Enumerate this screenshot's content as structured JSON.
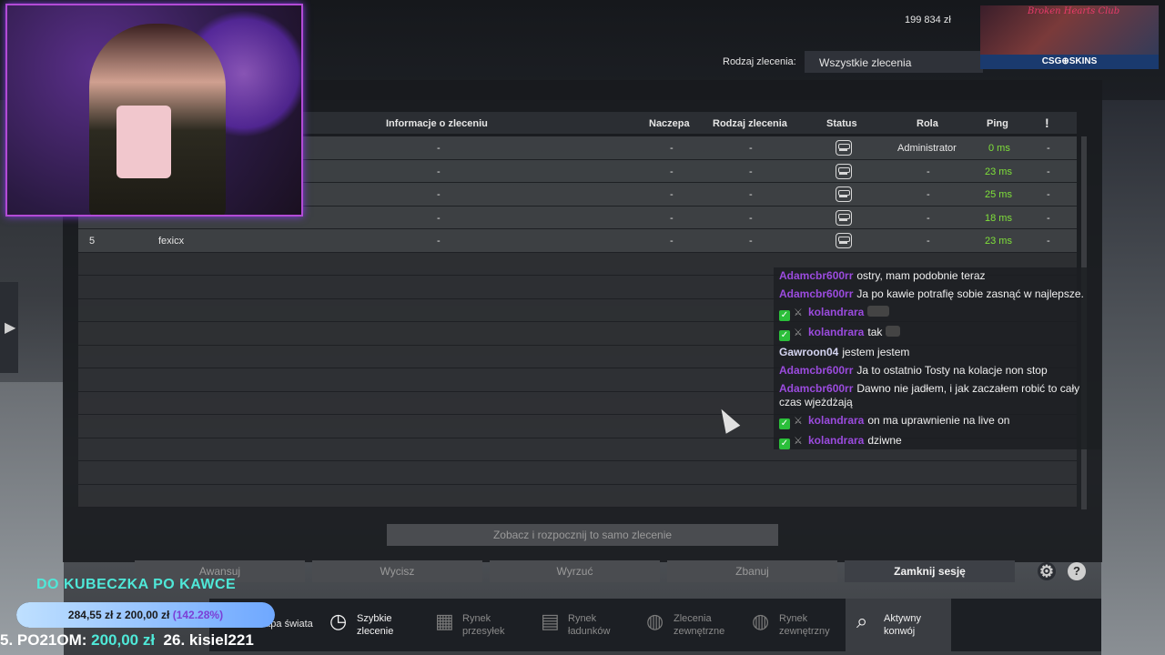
{
  "header": {
    "money": "199 834 zł",
    "order_type_label": "Rodzaj zlecenia:",
    "order_type_value": "Wszystkie zlecenia"
  },
  "sponsor": {
    "club_text": "Broken Hearts Club",
    "brand": "CSG⊕SKINS"
  },
  "table": {
    "columns": [
      "Informacje o zleceniu",
      "Naczepa",
      "Rodzaj zlecenia",
      "Status",
      "Rola",
      "Ping",
      "!"
    ],
    "rows": [
      {
        "num": "",
        "name": "",
        "info": "-",
        "trailer": "-",
        "type": "-",
        "role": "Administrator",
        "ping": "0 ms",
        "flag": "-"
      },
      {
        "num": "",
        "name": "",
        "info": "-",
        "trailer": "-",
        "type": "-",
        "role": "-",
        "ping": "23 ms",
        "flag": "-"
      },
      {
        "num": "",
        "name": "",
        "info": "-",
        "trailer": "-",
        "type": "-",
        "role": "-",
        "ping": "25 ms",
        "flag": "-"
      },
      {
        "num": "",
        "name": "",
        "info": "-",
        "trailer": "-",
        "type": "-",
        "role": "-",
        "ping": "18 ms",
        "flag": "-"
      },
      {
        "num": "5",
        "name": "fexicx",
        "info": "-",
        "trailer": "-",
        "type": "-",
        "role": "-",
        "ping": "23 ms",
        "flag": "-"
      }
    ]
  },
  "buttons": {
    "view_same": "Zobacz i rozpocznij to samo zlecenie",
    "promote": "Awansuj",
    "mute": "Wycisz",
    "kick": "Wyrzuć",
    "ban": "Zbanuj",
    "close_session": "Zamknij sesję",
    "help": "?"
  },
  "nav": {
    "map": "Mapa świata",
    "quick": "Szybkie\nzlecenie",
    "freight": "Rynek\nprzesyłek",
    "cargo": "Rynek\nładunków",
    "external": "Zlecenia\nzewnętrzne",
    "external_market": "Rynek\nzewnętrzny",
    "convoy": "Aktywny\nkonwój"
  },
  "chat": [
    {
      "user": "Adamcbr600rr",
      "color": "purple",
      "text": "ostry, mam podobnie teraz"
    },
    {
      "user": "Adamcbr600rr",
      "color": "purple",
      "text": "Ja po kawie potrafię sobie zasnąć w najlepsze."
    },
    {
      "user": "kolandrara",
      "color": "purple",
      "text": "",
      "badges": true,
      "emote": true
    },
    {
      "user": "kolandrara",
      "color": "purple",
      "text": "tak",
      "badges": true,
      "emote": true
    },
    {
      "user": "Gawroon04",
      "color": "white",
      "text": "jestem jestem"
    },
    {
      "user": "Adamcbr600rr",
      "color": "purple",
      "text": "Ja to ostatnio Tosty na kolacje non stop"
    },
    {
      "user": "Adamcbr600rr",
      "color": "purple",
      "text": "Dawno nie jadłem, i jak zaczałem robić to cały czas wjeżdżają"
    },
    {
      "user": "kolandrara",
      "color": "purple",
      "text": "on ma uprawnienie na live on",
      "badges": true
    },
    {
      "user": "kolandrara",
      "color": "purple",
      "text": "dziwne",
      "badges": true
    }
  ],
  "overlay": {
    "donation_title": "DO KUBECZKA PO KAWCE",
    "donation_current": "284,55 zł",
    "donation_sep": "z",
    "donation_goal": "200,00 zł",
    "donation_pct": "(142.28%)",
    "donation_fraction": 1.0,
    "ticker_1": "5. PO21OM: ",
    "ticker_1_amount": "200,00 zł",
    "ticker_2": "26. kisiel221"
  }
}
